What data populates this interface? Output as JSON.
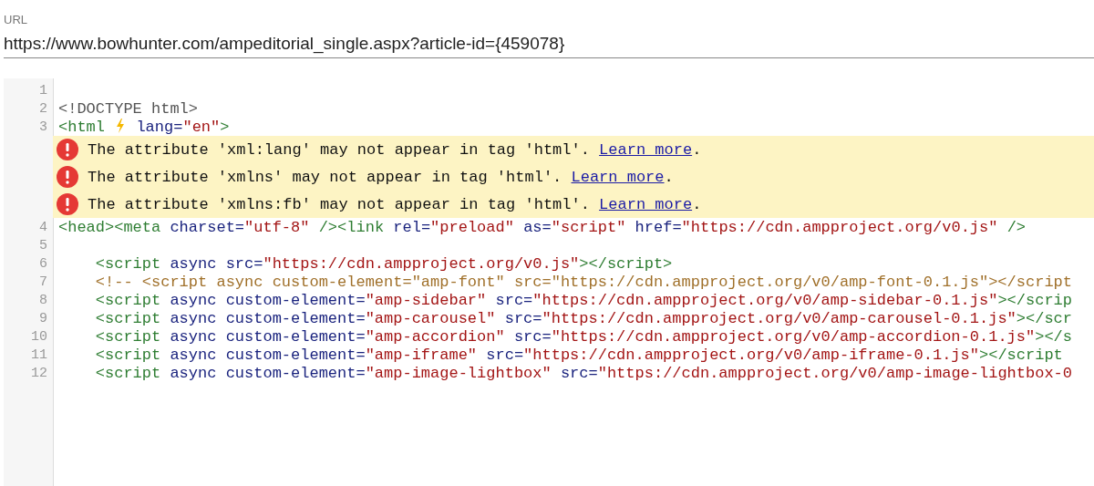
{
  "url_field": {
    "label": "URL",
    "value": "https://www.bowhunter.com/ampeditorial_single.aspx?article-id={459078}"
  },
  "lines": [
    {
      "kind": "code",
      "number": "1"
    },
    {
      "kind": "code",
      "number": "2",
      "tokens": [
        {
          "kind": "plain",
          "text": "<!DOCTYPE html>"
        }
      ]
    },
    {
      "kind": "code",
      "number": "3",
      "tokens": [
        {
          "kind": "tag",
          "text": "<html "
        },
        {
          "kind": "bolt"
        },
        {
          "kind": "attr",
          "text": " lang="
        },
        {
          "kind": "value",
          "text": "\"en\""
        },
        {
          "kind": "tag",
          "text": ">"
        }
      ]
    },
    {
      "kind": "error",
      "message": "The attribute 'xml:lang' may not appear in tag 'html'.",
      "link": "Learn more",
      "end": "."
    },
    {
      "kind": "error",
      "message": "The attribute 'xmlns' may not appear in tag 'html'.",
      "link": "Learn more",
      "end": "."
    },
    {
      "kind": "error",
      "message": "The attribute 'xmlns:fb' may not appear in tag 'html'.",
      "link": "Learn more",
      "end": "."
    },
    {
      "kind": "code",
      "number": "4",
      "tokens": [
        {
          "kind": "tag",
          "text": "<head><meta"
        },
        {
          "kind": "attr",
          "text": " charset="
        },
        {
          "kind": "value",
          "text": "\"utf-8\""
        },
        {
          "kind": "tag",
          "text": " /><link"
        },
        {
          "kind": "attr",
          "text": " rel="
        },
        {
          "kind": "value",
          "text": "\"preload\""
        },
        {
          "kind": "attr",
          "text": " as="
        },
        {
          "kind": "value",
          "text": "\"script\""
        },
        {
          "kind": "attr",
          "text": " href="
        },
        {
          "kind": "value",
          "text": "\"https://cdn.ampproject.org/v0.js\""
        },
        {
          "kind": "tag",
          "text": " />"
        }
      ]
    },
    {
      "kind": "code",
      "number": "5"
    },
    {
      "kind": "code",
      "number": "6",
      "tokens": [
        {
          "kind": "tag",
          "text": "    <script"
        },
        {
          "kind": "attr",
          "text": " async src="
        },
        {
          "kind": "value",
          "text": "\"https://cdn.ampproject.org/v0.js\""
        },
        {
          "kind": "tag",
          "text": "></script>"
        }
      ]
    },
    {
      "kind": "code",
      "number": "7",
      "tokens": [
        {
          "kind": "comment",
          "text": "    <!-- <script async custom-element=\"amp-font\" src=\"https://cdn.ampproject.org/v0/amp-font-0.1.js\"></script"
        }
      ]
    },
    {
      "kind": "code",
      "number": "8",
      "tokens": [
        {
          "kind": "tag",
          "text": "    <script"
        },
        {
          "kind": "attr",
          "text": " async custom-element="
        },
        {
          "kind": "value",
          "text": "\"amp-sidebar\""
        },
        {
          "kind": "attr",
          "text": " src="
        },
        {
          "kind": "value",
          "text": "\"https://cdn.ampproject.org/v0/amp-sidebar-0.1.js\""
        },
        {
          "kind": "tag",
          "text": "></scrip"
        }
      ]
    },
    {
      "kind": "code",
      "number": "9",
      "tokens": [
        {
          "kind": "tag",
          "text": "    <script"
        },
        {
          "kind": "attr",
          "text": " async custom-element="
        },
        {
          "kind": "value",
          "text": "\"amp-carousel\""
        },
        {
          "kind": "attr",
          "text": " src="
        },
        {
          "kind": "value",
          "text": "\"https://cdn.ampproject.org/v0/amp-carousel-0.1.js\""
        },
        {
          "kind": "tag",
          "text": "></scr"
        }
      ]
    },
    {
      "kind": "code",
      "number": "10",
      "tokens": [
        {
          "kind": "tag",
          "text": "    <script"
        },
        {
          "kind": "attr",
          "text": " async custom-element="
        },
        {
          "kind": "value",
          "text": "\"amp-accordion\""
        },
        {
          "kind": "attr",
          "text": " src="
        },
        {
          "kind": "value",
          "text": "\"https://cdn.ampproject.org/v0/amp-accordion-0.1.js\""
        },
        {
          "kind": "tag",
          "text": "></s"
        }
      ]
    },
    {
      "kind": "code",
      "number": "11",
      "tokens": [
        {
          "kind": "tag",
          "text": "    <script"
        },
        {
          "kind": "attr",
          "text": " async custom-element="
        },
        {
          "kind": "value",
          "text": "\"amp-iframe\""
        },
        {
          "kind": "attr",
          "text": " src="
        },
        {
          "kind": "value",
          "text": "\"https://cdn.ampproject.org/v0/amp-iframe-0.1.js\""
        },
        {
          "kind": "tag",
          "text": "></script"
        }
      ]
    },
    {
      "kind": "code",
      "number": "12",
      "tokens": [
        {
          "kind": "tag",
          "text": "    <script"
        },
        {
          "kind": "attr",
          "text": " async custom-element="
        },
        {
          "kind": "value",
          "text": "\"amp-image-lightbox\""
        },
        {
          "kind": "attr",
          "text": " src="
        },
        {
          "kind": "value",
          "text": "\"https://cdn.ampproject.org/v0/amp-image-lightbox-0"
        }
      ]
    }
  ]
}
